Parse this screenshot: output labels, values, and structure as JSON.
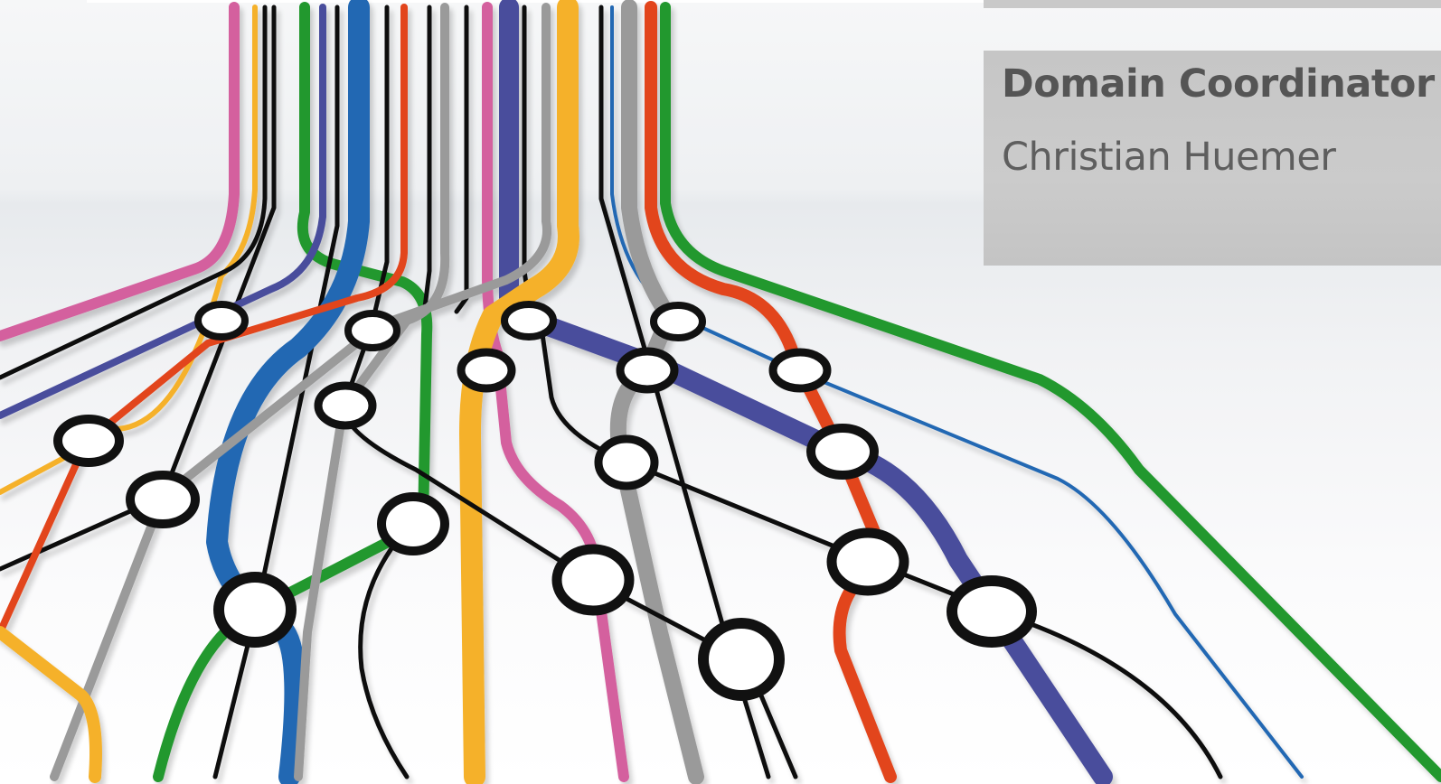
{
  "slide": {
    "title": "Domain Coordinator",
    "name": "Christian Huemer"
  },
  "artwork": {
    "description_icon": "transit-network-map-icon",
    "line_colors": {
      "pink": "#d4609e",
      "yellow": "#f5b12a",
      "black": "#111111",
      "green": "#22982f",
      "purple": "#4a4d9c",
      "blue": "#2268b3",
      "red": "#e2451d",
      "gray": "#9a9a9a"
    }
  },
  "theme": {
    "panel_background": "#c8c8c8",
    "title_text": "#555555",
    "name_text": "#5e5e5e"
  }
}
